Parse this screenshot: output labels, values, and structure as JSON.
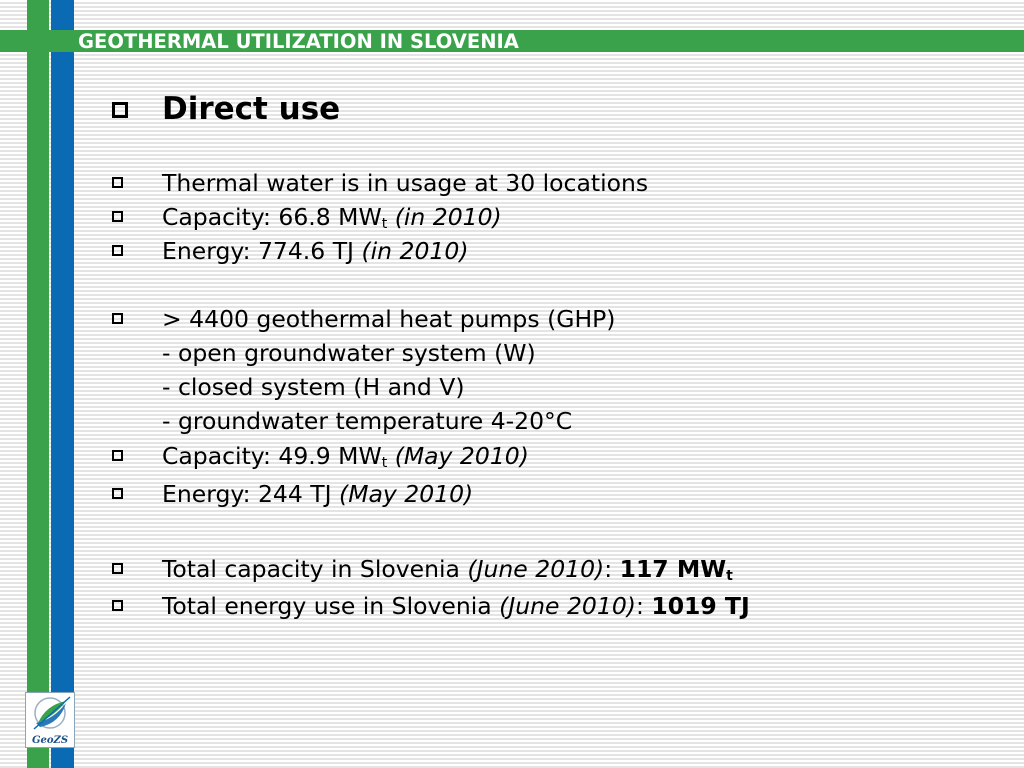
{
  "slide": {
    "title": "GEOTHERMAL UTILIZATION IN SLOVENIA",
    "heading": "Direct use",
    "items": [
      {
        "text": "Thermal water is in usage at 30 locations"
      },
      {
        "prefix": "Capacity:  66.8  MW",
        "sub": "t",
        "italic": " (in 2010)"
      },
      {
        "prefix": "Energy: 774.6 TJ ",
        "italic": "(in 2010)"
      },
      {
        "text": "> 4400 geothermal heat pumps (GHP)"
      },
      {
        "text": "- open groundwater system (W)"
      },
      {
        "text": "- closed system (H and V)"
      },
      {
        "text": "- groundwater temperature 4-20°C"
      },
      {
        "prefix": "Capacity: 49.9 MW",
        "sub": "t",
        "italic": " (May 2010)"
      },
      {
        "prefix": "Energy: 244 TJ ",
        "italic": "(May 2010)"
      },
      {
        "prefix": "Total capacity in Slovenia ",
        "italic": "(June 2010)",
        "sep": ": ",
        "bold": "117 MW",
        "bold_sub": "t"
      },
      {
        "prefix": "Total energy use in Slovenia ",
        "italic": "(June 2010)",
        "sep": ": ",
        "bold": "1019 TJ"
      }
    ]
  },
  "logo": {
    "text": "GeoZS"
  },
  "colors": {
    "green": "#3aa24a",
    "blue": "#0a6ab3",
    "title_text": "#ffffff"
  }
}
